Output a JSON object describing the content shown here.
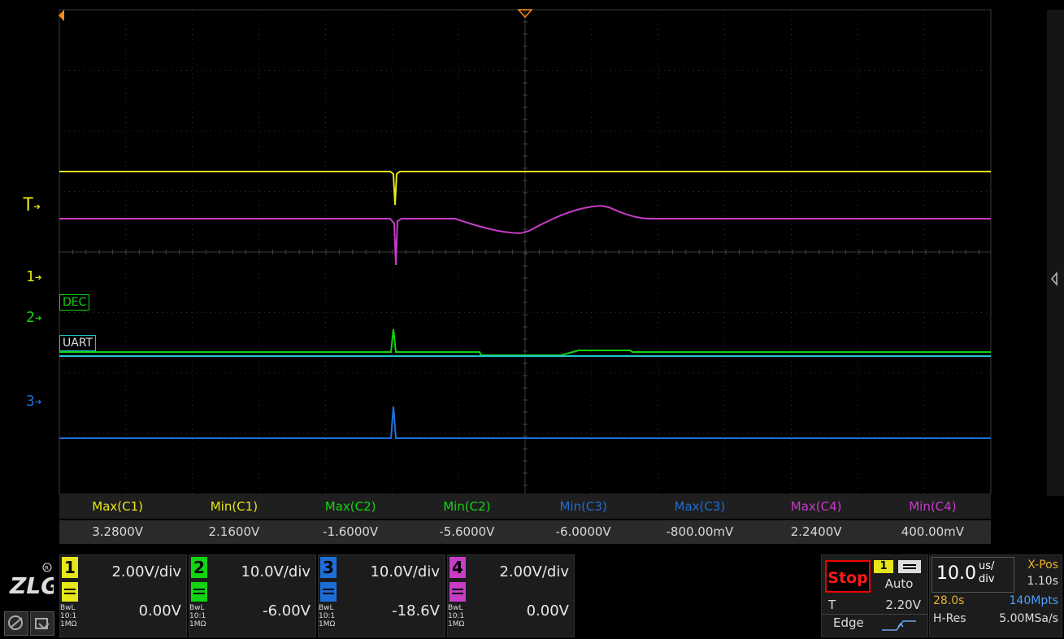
{
  "colors": {
    "ch1": "#e6e61a",
    "ch2": "#12d412",
    "ch3": "#1e6ed8",
    "ch4": "#c83cc8",
    "grid": "#3a3a3a",
    "trigger": "#ff8c1a",
    "uart": "#1ec8c8"
  },
  "markers": {
    "trigger_label": "T",
    "ch1_label": "1",
    "ch2_label": "2",
    "ch3_label": "3",
    "dec_label": "DEC",
    "uart_label": "UART"
  },
  "measurements": [
    {
      "label": "Max(C1)",
      "value": "3.2800V",
      "color": "#e6e61a"
    },
    {
      "label": "Min(C1)",
      "value": "2.1600V",
      "color": "#e6e61a"
    },
    {
      "label": "Max(C2)",
      "value": "-1.6000V",
      "color": "#12d412"
    },
    {
      "label": "Min(C2)",
      "value": "-5.6000V",
      "color": "#12d412"
    },
    {
      "label": "Min(C3)",
      "value": "-6.0000V",
      "color": "#1e6ed8"
    },
    {
      "label": "Max(C3)",
      "value": "-800.00mV",
      "color": "#1e6ed8"
    },
    {
      "label": "Max(C4)",
      "value": "2.2400V",
      "color": "#c83cc8"
    },
    {
      "label": "Min(C4)",
      "value": "400.00mV",
      "color": "#c83cc8"
    }
  ],
  "channels": [
    {
      "num": "1",
      "scale": "2.00V/div",
      "offset": "0.00V",
      "bw": "BwL",
      "probe": "10:1",
      "imp": "1MΩ",
      "color": "#e6e61a"
    },
    {
      "num": "2",
      "scale": "10.0V/div",
      "offset": "-6.00V",
      "bw": "BwL",
      "probe": "10:1",
      "imp": "1MΩ",
      "color": "#12d412"
    },
    {
      "num": "3",
      "scale": "10.0V/div",
      "offset": "-18.6V",
      "bw": "BwL",
      "probe": "10:1",
      "imp": "1MΩ",
      "color": "#1e6ed8"
    },
    {
      "num": "4",
      "scale": "2.00V/div",
      "offset": "0.00V",
      "bw": "BwL",
      "probe": "10:1",
      "imp": "1MΩ",
      "color": "#c83cc8"
    }
  ],
  "trigger": {
    "state": "Stop",
    "source": "1",
    "mode": "Auto",
    "label": "T",
    "level": "2.20V",
    "type": "Edge"
  },
  "timebase": {
    "value": "10.0",
    "unit_top": "us/",
    "unit_bottom": "div",
    "xpos_label": "X-Pos",
    "xpos_value": "1.10s",
    "duration": "28.0s",
    "memory": "140Mpts",
    "acq_mode": "H-Res",
    "sample_rate": "5.00MSa/s"
  },
  "icons": [
    "zlg-logo",
    "touch-icon",
    "gesture-icon",
    "trigger-pos-icon",
    "offset-arrow-icon",
    "side-panel-icon",
    "edge-rising-icon"
  ]
}
